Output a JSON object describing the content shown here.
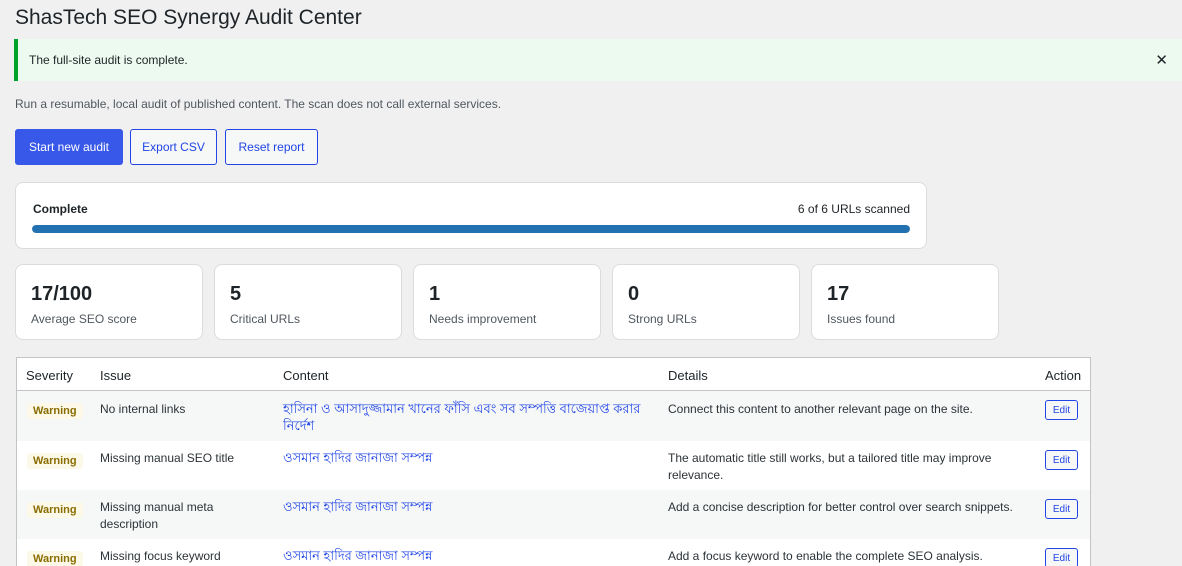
{
  "page": {
    "title": "ShasTech SEO Synergy Audit Center",
    "notice": "The full-site audit is complete.",
    "intro": "Run a resumable, local audit of published content. The scan does not call external services."
  },
  "buttons": {
    "start": "Start new audit",
    "export": "Export CSV",
    "reset": "Reset report"
  },
  "progress": {
    "status": "Complete",
    "count_text": "6 of 6 URLs scanned",
    "percent": 100
  },
  "stats": [
    {
      "value": "17/100",
      "label": "Average SEO score"
    },
    {
      "value": "5",
      "label": "Critical URLs"
    },
    {
      "value": "1",
      "label": "Needs improvement"
    },
    {
      "value": "0",
      "label": "Strong URLs"
    },
    {
      "value": "17",
      "label": "Issues found"
    }
  ],
  "table": {
    "headers": {
      "severity": "Severity",
      "issue": "Issue",
      "content": "Content",
      "details": "Details",
      "action": "Action"
    },
    "rows": [
      {
        "severity": "Warning",
        "issue": "No internal links",
        "content": "হাসিনা ও আসাদুজ্জামান খানের ফাঁসি এবং সব সম্পত্তি বাজেয়াপ্ত করার নির্দেশ",
        "details": "Connect this content to another relevant page on the site.",
        "action": "Edit"
      },
      {
        "severity": "Warning",
        "issue": "Missing manual SEO title",
        "content": "ওসমান হাদির জানাজা সম্পন্ন",
        "details": "The automatic title still works, but a tailored title may improve relevance.",
        "action": "Edit"
      },
      {
        "severity": "Warning",
        "issue": "Missing manual meta description",
        "content": "ওসমান হাদির জানাজা সম্পন্ন",
        "details": "Add a concise description for better control over search snippets.",
        "action": "Edit"
      },
      {
        "severity": "Warning",
        "issue": "Missing focus keyword",
        "content": "ওসমান হাদির জানাজা সম্পন্ন",
        "details": "Add a focus keyword to enable the complete SEO analysis.",
        "action": "Edit"
      }
    ]
  },
  "icons": {
    "close": "close-icon"
  }
}
